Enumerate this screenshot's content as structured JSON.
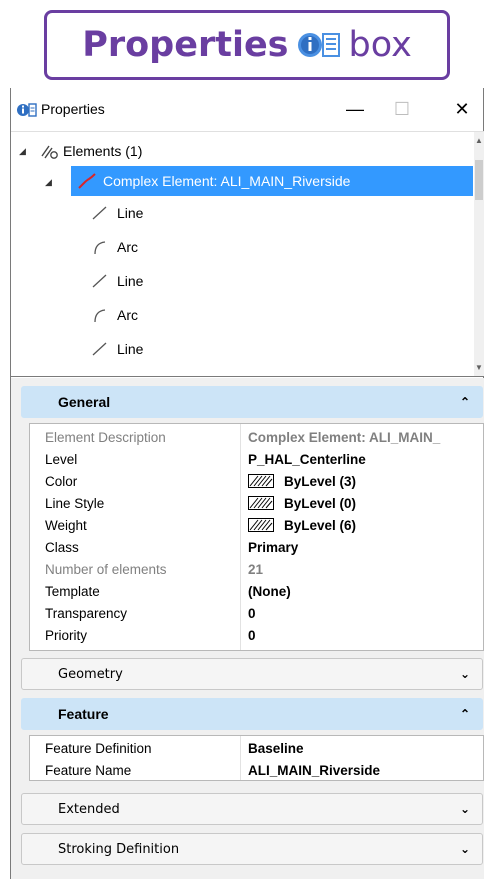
{
  "banner": {
    "bold_text": "Properties",
    "light_text": "box"
  },
  "window": {
    "title": "Properties",
    "controls": {
      "minimize": "—",
      "maximize": "☐",
      "close": "✕"
    }
  },
  "tree": {
    "root": {
      "label": "Elements (1)",
      "expander": "◢"
    },
    "selected": {
      "label": "Complex Element: ALI_MAIN_Riverside",
      "expander": "◢"
    },
    "children": [
      {
        "label": "Line",
        "icon": "line-icon"
      },
      {
        "label": "Arc",
        "icon": "arc-icon"
      },
      {
        "label": "Line",
        "icon": "line-icon"
      },
      {
        "label": "Arc",
        "icon": "arc-icon"
      },
      {
        "label": "Line",
        "icon": "line-icon"
      }
    ]
  },
  "sections": {
    "general": {
      "title": "General",
      "rows": [
        {
          "name": "Element Description",
          "value": "Complex Element: ALI_MAIN_",
          "dim": true
        },
        {
          "name": "Level",
          "value": "P_HAL_Centerline"
        },
        {
          "name": "Color",
          "value": "ByLevel (3)",
          "swatch": true
        },
        {
          "name": "Line Style",
          "value": "ByLevel (0)",
          "swatch": true
        },
        {
          "name": "Weight",
          "value": "ByLevel (6)",
          "swatch": true
        },
        {
          "name": "Class",
          "value": "Primary"
        },
        {
          "name": "Number of elements",
          "value": "21",
          "dim": true
        },
        {
          "name": "Template",
          "value": "(None)"
        },
        {
          "name": "Transparency",
          "value": "0"
        },
        {
          "name": "Priority",
          "value": "0"
        }
      ]
    },
    "geometry": {
      "title": "Geometry"
    },
    "feature": {
      "title": "Feature",
      "rows": [
        {
          "name": "Feature Definition",
          "value": "Baseline"
        },
        {
          "name": "Feature Name",
          "value": "ALI_MAIN_Riverside"
        }
      ]
    },
    "extended": {
      "title": "Extended"
    },
    "stroking": {
      "title": "Stroking Definition"
    }
  },
  "icons": {
    "collapse": "chevron-up-icon",
    "expand": "chevron-down-icon"
  },
  "colors": {
    "accent": "#6a3ea1",
    "selection": "#3399ff",
    "section_open": "#cce4f7",
    "curve_red": "#d8262a"
  }
}
